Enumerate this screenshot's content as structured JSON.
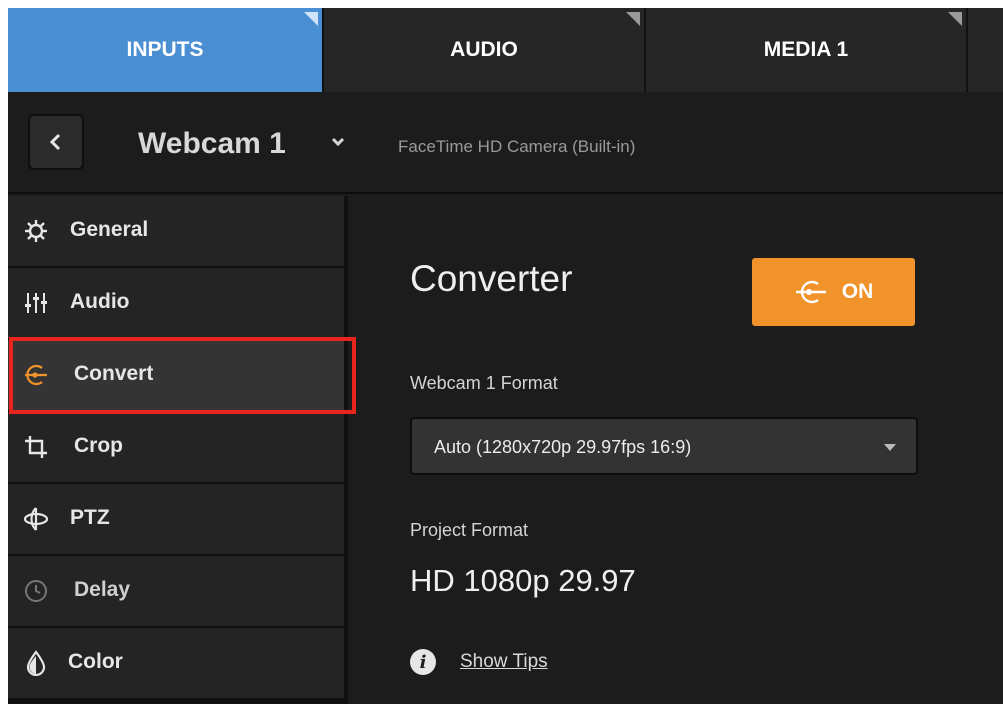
{
  "tabs": [
    {
      "label": "INPUTS",
      "active": true
    },
    {
      "label": "AUDIO",
      "active": false
    },
    {
      "label": "MEDIA 1",
      "active": false
    }
  ],
  "header": {
    "back_icon": "chevron-left-icon",
    "source_name": "Webcam 1",
    "dropdown_icon": "chevron-down-icon",
    "source_description": "FaceTime HD Camera (Built-in)"
  },
  "sidebar": {
    "items": [
      {
        "label": "General",
        "icon": "gear-icon"
      },
      {
        "label": "Audio",
        "icon": "audio-mixer-icon"
      },
      {
        "label": "Convert",
        "icon": "convert-icon",
        "selected": true
      },
      {
        "label": "Crop",
        "icon": "crop-icon"
      },
      {
        "label": "PTZ",
        "icon": "ptz-icon"
      },
      {
        "label": "Delay",
        "icon": "clock-icon"
      },
      {
        "label": "Color",
        "icon": "color-drop-icon"
      }
    ]
  },
  "main": {
    "title": "Converter",
    "toggle": {
      "label": "ON",
      "icon": "convert-icon"
    },
    "format_label": "Webcam 1 Format",
    "format_value": "Auto (1280x720p 29.97fps 16:9)",
    "project_format_label": "Project Format",
    "project_format_value": "HD 1080p 29.97",
    "tips_icon": "info-icon",
    "tips_link": "Show Tips"
  },
  "colors": {
    "active_tab": "#4a8fd2",
    "accent_orange": "#f0932b",
    "highlight_red": "#e8251d",
    "background": "#1c1c1c"
  }
}
